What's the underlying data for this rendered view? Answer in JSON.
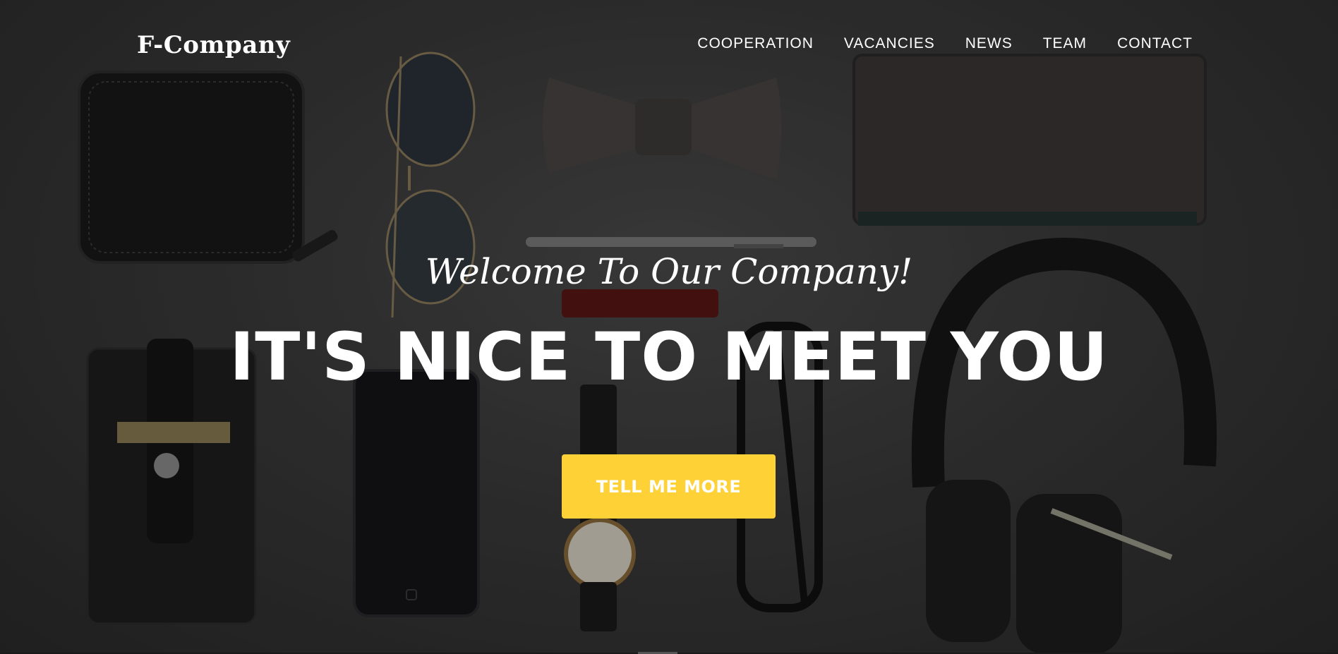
{
  "brand": {
    "name": "F-Company"
  },
  "nav": {
    "items": [
      {
        "label": "COOPERATION"
      },
      {
        "label": "VACANCIES"
      },
      {
        "label": "NEWS"
      },
      {
        "label": "TEAM"
      },
      {
        "label": "CONTACT"
      }
    ]
  },
  "hero": {
    "lead": "Welcome To Our Company!",
    "heading": "IT'S NICE TO MEET YOU",
    "cta_label": "TELL ME MORE"
  },
  "colors": {
    "accent": "#fed136",
    "text": "#ffffff",
    "background": "#2b2b2b"
  }
}
